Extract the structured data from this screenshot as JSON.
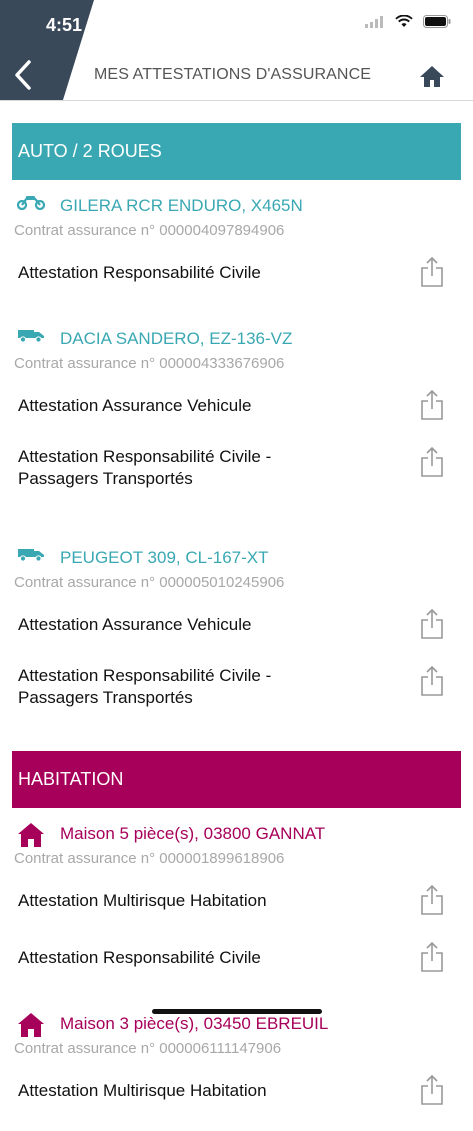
{
  "status_bar": {
    "time": "4:51"
  },
  "header": {
    "title": "MES ATTESTATIONS D'ASSURANCE"
  },
  "colors": {
    "auto": "#3aa8b3",
    "habitation": "#a7005a",
    "dark": "#39495a"
  },
  "sections": [
    {
      "title": "AUTO / 2 ROUES",
      "items": [
        {
          "icon": "motorcycle-icon",
          "title": "GILERA RCR ENDURO, X465N",
          "contract": "Contrat assurance n° 000004097894906",
          "docs": [
            {
              "lines": [
                "Attestation Responsabilité Civile"
              ]
            }
          ]
        },
        {
          "icon": "van-icon",
          "title": "DACIA SANDERO, EZ-136-VZ",
          "contract": "Contrat assurance n° 000004333676906",
          "docs": [
            {
              "lines": [
                "Attestation Assurance Vehicule"
              ]
            },
            {
              "lines": [
                "Attestation Responsabilité Civile -",
                "Passagers Transportés"
              ]
            }
          ]
        },
        {
          "icon": "van-icon",
          "title": "PEUGEOT 309, CL-167-XT",
          "contract": "Contrat assurance n° 000005010245906",
          "docs": [
            {
              "lines": [
                "Attestation Assurance Vehicule"
              ]
            },
            {
              "lines": [
                "Attestation Responsabilité Civile -",
                "Passagers Transportés"
              ]
            }
          ]
        }
      ]
    },
    {
      "title": "HABITATION",
      "items": [
        {
          "icon": "house-icon",
          "title": "Maison 5 pièce(s), 03800 GANNAT",
          "contract": "Contrat assurance n° 000001899618906",
          "docs": [
            {
              "lines": [
                "Attestation Multirisque Habitation"
              ]
            },
            {
              "lines": [
                "Attestation Responsabilité Civile"
              ]
            }
          ]
        },
        {
          "icon": "house-icon",
          "title": "Maison 3 pièce(s), 03450 EBREUIL",
          "contract": "Contrat assurance n° 000006111147906",
          "docs": [
            {
              "lines": [
                "Attestation Multirisque Habitation"
              ]
            }
          ]
        }
      ]
    }
  ]
}
